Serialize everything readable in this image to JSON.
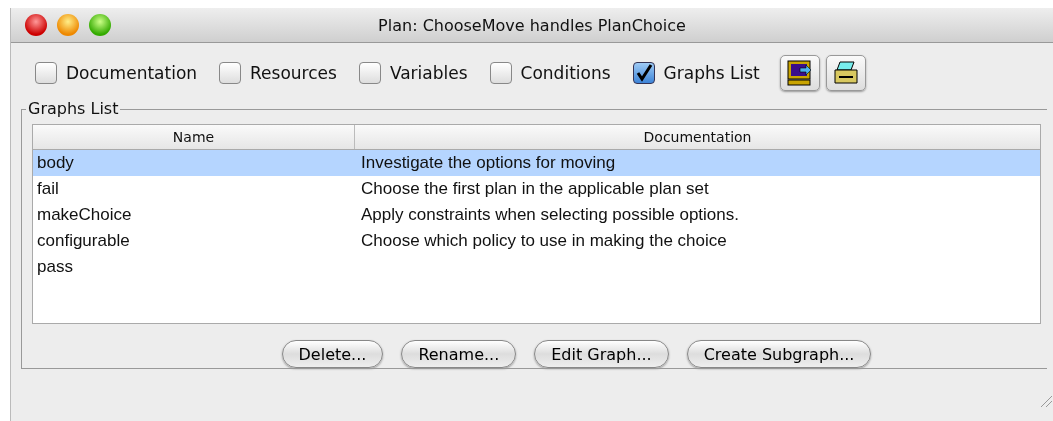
{
  "window": {
    "title": "Plan: ChooseMove handles PlanChoice"
  },
  "toolbar": {
    "checkboxes": [
      {
        "label": "Documentation",
        "checked": false
      },
      {
        "label": "Resources",
        "checked": false
      },
      {
        "label": "Variables",
        "checked": false
      },
      {
        "label": "Conditions",
        "checked": false
      },
      {
        "label": "Graphs List",
        "checked": true
      }
    ]
  },
  "group": {
    "title": "Graphs List"
  },
  "table": {
    "columns": [
      "Name",
      "Documentation"
    ],
    "rows": [
      {
        "cells": [
          "body",
          "Investigate the options for moving"
        ],
        "selected": true
      },
      {
        "cells": [
          "fail",
          "Choose the first plan in the applicable plan set"
        ],
        "selected": false
      },
      {
        "cells": [
          "makeChoice",
          "Apply constraints when selecting possible options."
        ],
        "selected": false
      },
      {
        "cells": [
          "configurable",
          "Choose which policy to use in making the choice"
        ],
        "selected": false
      },
      {
        "cells": [
          "pass",
          ""
        ],
        "selected": false
      }
    ]
  },
  "buttons": [
    "Delete...",
    "Rename...",
    "Edit Graph...",
    "Create Subgraph..."
  ]
}
